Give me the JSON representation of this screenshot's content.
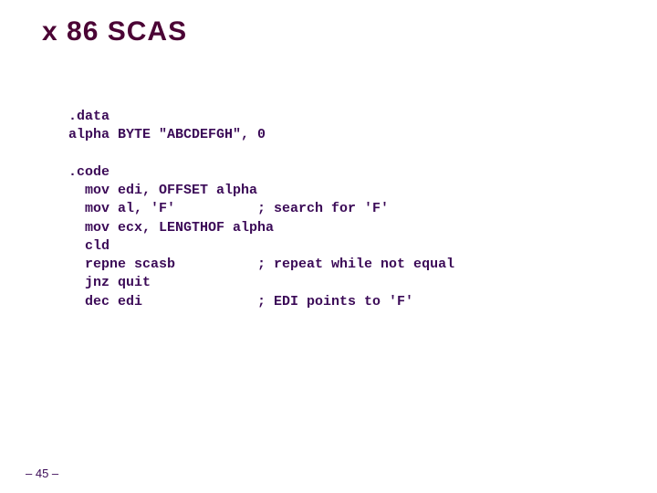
{
  "title": "x 86 SCAS",
  "code": ".data\nalpha BYTE \"ABCDEFGH\", 0\n\n.code\n  mov edi, OFFSET alpha\n  mov al, 'F'          ; search for 'F'\n  mov ecx, LENGTHOF alpha\n  cld\n  repne scasb          ; repeat while not equal\n  jnz quit\n  dec edi              ; EDI points to 'F'",
  "footer": "– 45 –"
}
